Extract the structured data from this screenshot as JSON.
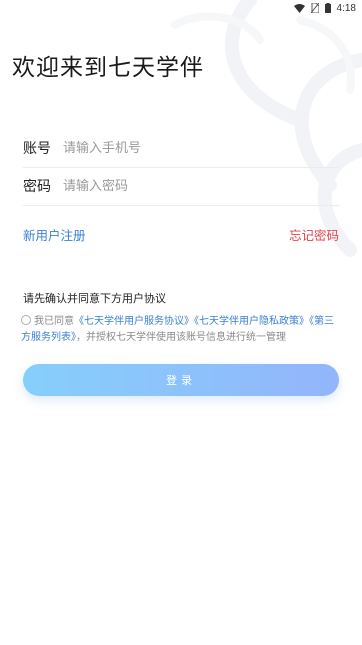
{
  "status_bar": {
    "time": "4:18",
    "icons": [
      "wifi-icon",
      "no-sim-icon",
      "battery-icon"
    ]
  },
  "welcome_title": "欢迎来到七天学伴",
  "form": {
    "account_label": "账号",
    "account_placeholder": "请输入手机号",
    "account_value": "",
    "password_label": "密码",
    "password_placeholder": "请输入密码",
    "password_value": ""
  },
  "links": {
    "register": "新用户注册",
    "forgot": "忘记密码"
  },
  "agreement": {
    "title": "请先确认并同意下方用户协议",
    "checked": false,
    "prefix": "我已同意",
    "service_agreement": "《七天学伴用户服务协议》",
    "privacy_policy": "《七天学伴用户隐私政策》",
    "third_party": "《第三方服务列表》",
    "suffix": "，并授权七天学伴使用该账号信息进行统一管理"
  },
  "login_button": "登录",
  "colors": {
    "link_blue": "#3a7fd5",
    "forgot_red": "#e2434d",
    "button_gradient_start": "#86cffb",
    "button_gradient_end": "#93b5fb"
  }
}
